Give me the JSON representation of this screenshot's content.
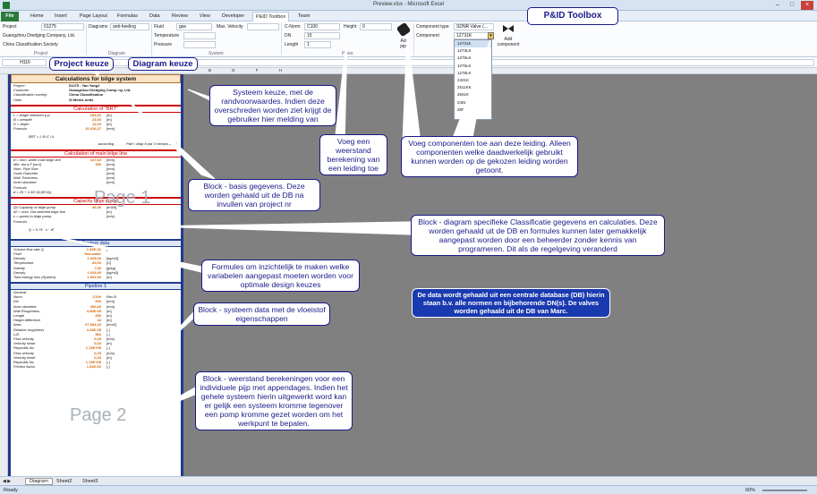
{
  "window": {
    "title": "Preview.xlsx - Microsoft Excel"
  },
  "tabs": [
    "File",
    "Home",
    "Insert",
    "Page Layout",
    "Formulas",
    "Data",
    "Review",
    "View",
    "Developer",
    "P&ID Toolbox",
    "Team"
  ],
  "ribbon": {
    "project_label": "Project",
    "project_value": "01275",
    "company": "Guangzhou Dredging Company, Ltd.",
    "society": "China Classification Society",
    "diagrams_label": "Diagrams",
    "diagrams_value": "anti-heeling",
    "fluid_label": "Fluid",
    "fluid_value": "gas",
    "temperature_label": "Temperature",
    "pressure_label": "Pressure",
    "maxvel_label": "Max. Velocity",
    "cnorm_label": "C-Norm",
    "cnorm_value": "C100",
    "dn_label": "DN",
    "dn_value": "15",
    "length_label": "Length",
    "length_value": "1",
    "height_label": "Height",
    "height_value": "0",
    "add_pipe": "Add pipe",
    "comptype_label": "Component type",
    "comptype_value": "SDNR Valve (...",
    "component_label": "Component",
    "component_value": "12731K",
    "add_component": "Add component",
    "groups": {
      "project": "Project",
      "diagram": "Diagram",
      "system": "System",
      "pipes": "Pipes"
    }
  },
  "dropdown": [
    "12731K",
    "1273LK",
    "1276LK",
    "1276LK",
    "1278LK",
    "2421K",
    "2511KK",
    "2641K",
    "2461K",
    "2891K"
  ],
  "namebox": "H116",
  "columns": "B D F H",
  "sheet": {
    "title": "Calculations for bilge system",
    "info": [
      [
        "Project :",
        "01275 - Yan Yang1"
      ],
      [
        "Customer",
        "Guangzhou Dredging Company, Ltd."
      ],
      [
        "Classification society:",
        "China Classification"
      ],
      [
        "Units",
        "SI Metric units"
      ]
    ],
    "sec_brt": "Calculation of \"BRT\"",
    "brt_rows": [
      [
        "L = length between p.p.",
        "154,00",
        "[m]"
      ],
      [
        "B = breadth",
        "23,00",
        "[m]"
      ],
      [
        "D = depth",
        "12,20",
        "[m]"
      ],
      [
        "Formula",
        "10.416,27",
        "[mm]"
      ]
    ],
    "brt_formula": "BRT = L·B·C / k",
    "according": "according",
    "rule": "Part I chap 8 par 3 version 2016",
    "sec_main": "Calculation of main bilge line",
    "main_rows": [
      [
        "d = nom. width main bilge line",
        "167,63",
        "[mm]"
      ],
      [
        "Min. dia a.F [mm]",
        "150",
        "[mm]"
      ],
      [
        "Nom. Pipe Size",
        "",
        "[mm]"
      ],
      [
        "Outer Diameter",
        "",
        "[mm]"
      ],
      [
        "Wall Thickness",
        "",
        "[mm]"
      ],
      [
        "Inner diameter",
        "",
        "[mm]"
      ],
      [
        "Formula",
        "",
        ""
      ]
    ],
    "main_formula": "d = 25 + 1.68·√(L(B+D))",
    "sec_pump": "Capacity bilge pump",
    "pump_rows": [
      [
        "Q0 Capacity of bilge pump",
        "46,00",
        "[m3/h]"
      ],
      [
        "d2 = nom. Dia selected bilge line",
        "",
        "[m]"
      ],
      [
        "v = speed in bilge pump",
        "",
        "[m/s]"
      ],
      [
        "Formula",
        "",
        ""
      ]
    ],
    "pump_formula": "Q = 5.75 · v · d²",
    "sec_system": "System data",
    "system_rows": [
      [
        "Volume flow rate Q",
        "1.51E-02",
        "[m3/s]"
      ],
      [
        "Fluid",
        "Sea water",
        ""
      ],
      [
        "Density",
        "1.025,00",
        "[kg/m3]"
      ],
      [
        "Temperature",
        "20,00",
        "[C]"
      ],
      [
        "Salinity",
        "7,00",
        "[g/kg]"
      ],
      [
        "Density",
        "1.023,00",
        "[kg/m3]"
      ],
      [
        "Total energy loss (System)",
        "1.091,00",
        "[m]"
      ]
    ],
    "sec_pipeline": "Pipeline 1",
    "pipeline_rows": [
      [
        "General",
        "",
        ""
      ],
      [
        "Norm",
        "C100",
        "Rev B"
      ],
      [
        "DN",
        "250",
        "[mm]"
      ],
      [
        "Inner diameter",
        "260,40",
        "[mm]"
      ],
      [
        "Wall Roughness",
        "4.50E-05",
        "[m]"
      ],
      [
        "Length",
        "250",
        "[m]"
      ],
      [
        "Height difference",
        "34",
        "[m]"
      ],
      [
        "Area",
        "67.534,20",
        "[mm2]"
      ],
      [
        "Relative roughness",
        "3.33E-05",
        "[-]"
      ],
      [
        "L/D",
        "962",
        "[-]"
      ],
      [
        "Flow velocity",
        "0,25",
        "[m/s]"
      ],
      [
        "Velocity head",
        "0,03",
        "[m]"
      ],
      [
        "Reynolds No",
        "1,74E+05",
        "[-]"
      ],
      [
        "Flow velocity",
        "0,25",
        "[m/s]"
      ],
      [
        "Velocity head",
        "0,03",
        "[m]"
      ],
      [
        "Reynolds No",
        "1,74E+05",
        "[-]"
      ],
      [
        "Friction factor",
        "1,51E-02",
        "[-]"
      ]
    ],
    "page1": "Page 1",
    "page2": "Page 2"
  },
  "labels": {
    "project_keuze": "Project keuze",
    "diagram_keuze": "Diagram keuze",
    "toolbox": "P&ID Toolbox"
  },
  "callouts": {
    "systeem": "Systeem keuze, met de randvoorwaardes. Indien deze overschreden worden ziet krijgt de gebruiker hier melding van",
    "voeg_weerstand": "Voeg een weerstand berekening van een leiding toe",
    "voeg_componenten": "Voeg componenten toe aan deze leiding. Alleen componenten welke daadwerkelijk gebruikt kunnen worden op de gekozen leiding worden getoont.",
    "basis": "Block - basis gegevens. Deze worden gehaald uit de DB na invullen van project nr",
    "diagram_spec": "Block - diagram specifieke Classificatie gegevens en calculaties. Deze worden gehaald uit de DB en formules kunnen later gemakkelijk aangepast worden door een beheerder zonder kennis van programeren. Dit als de regelgeving veranderd",
    "formules": "Formules om inzichtelijk te maken welke variabelen aangepast moeten worden voor optimale design keuzes",
    "database": "De data wordt gehaald uit een centrale database (DB) hierin staan b.v. alle normen en bijbehorende DN(s). De valves worden gehaald uit de DB van Marc.",
    "systeem_data": "Block - systeem data met de vloeistof eigenschappen",
    "weerstand": "Block - weerstand berekeningen voor een individuele pijp met appendages. Indien het gehele systeem hierin uitgewerkt word kan er gelijk een systeem kromme tegenover een pomp kromme gezet worden om het werkpunt te bepalen."
  },
  "sheet_tabs": [
    "Diagram",
    "Sheet2",
    "Sheet3"
  ],
  "status": {
    "ready": "Ready",
    "zoom": "60%"
  }
}
